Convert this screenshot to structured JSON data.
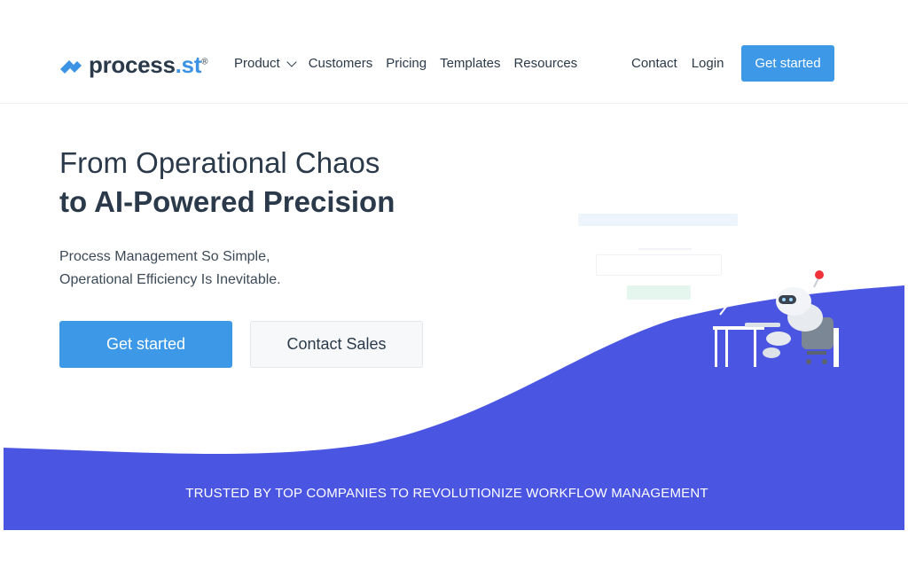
{
  "brand": {
    "name_main": "process",
    "name_dot": ".st",
    "trademark": "®"
  },
  "nav": {
    "items": [
      {
        "label": "Product",
        "has_dropdown": true
      },
      {
        "label": "Customers"
      },
      {
        "label": "Pricing"
      },
      {
        "label": "Templates"
      },
      {
        "label": "Resources"
      }
    ],
    "right": {
      "contact": "Contact",
      "login": "Login",
      "cta": "Get started"
    }
  },
  "hero": {
    "title_line1": "From Operational Chaos",
    "title_line2": "to AI-Powered Precision",
    "subtitle_line1": "Process Management So Simple,",
    "subtitle_line2": "Operational Efficiency Is Inevitable.",
    "primary_cta": "Get started",
    "secondary_cta": "Contact Sales"
  },
  "trusted": {
    "text": "TRUSTED BY TOP COMPANIES TO REVOLUTIONIZE WORKFLOW MANAGEMENT"
  },
  "colors": {
    "accent": "#3d98e8",
    "wave": "#4a56e2",
    "text": "#2b3a4a"
  },
  "icons": {
    "logo": "process-st-logo-mark",
    "robot": "robot-at-desk-illustration"
  }
}
